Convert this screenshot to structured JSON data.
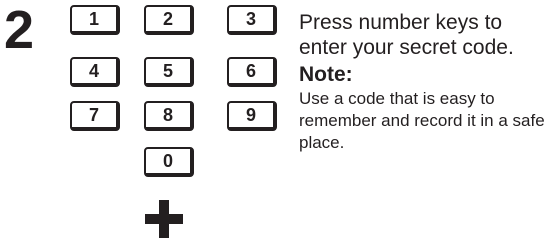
{
  "step": {
    "number": "2"
  },
  "keypad": {
    "keys": [
      "1",
      "2",
      "3",
      "4",
      "5",
      "6",
      "7",
      "8",
      "9",
      "0"
    ]
  },
  "instructions": {
    "main_text": "Press number keys to enter your secret code.",
    "note_heading": "Note:",
    "note_text": "Use a code that is easy to remember and record it in a safe place."
  }
}
